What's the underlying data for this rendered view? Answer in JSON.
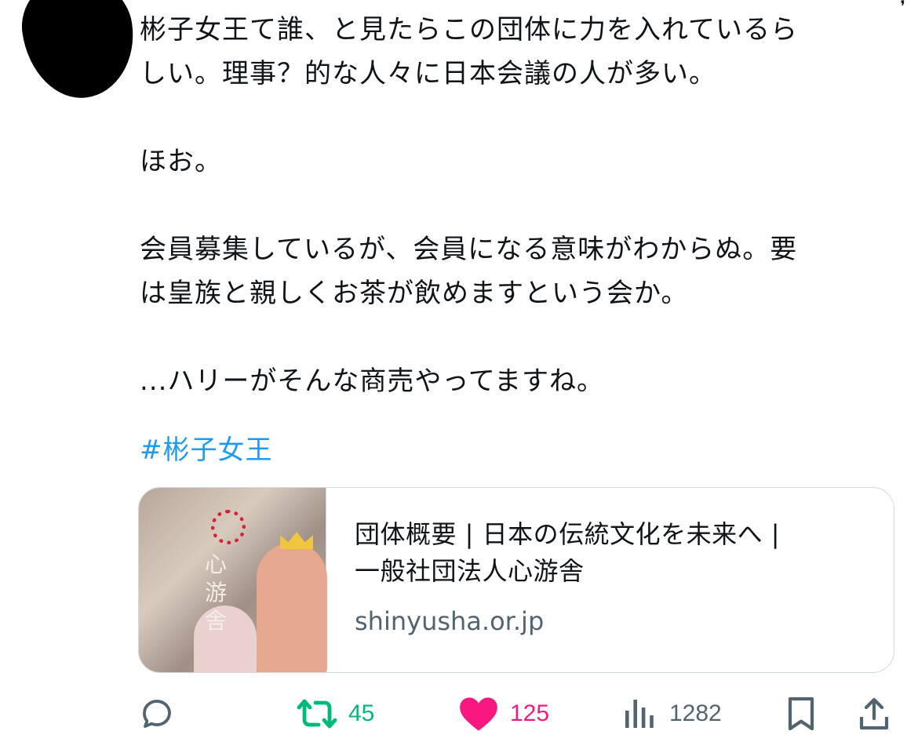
{
  "tweet": {
    "paragraphs": [
      "彬子女王て誰、と見たらこの団体に力を入れているら\nしい。理事？的な人々に日本会議の人が多い。",
      "ほお。",
      "会員募集しているが、会員になる意味がわからぬ。要\nは皇族と親しくお茶が飲めますという会か。",
      "...ハリーがそんな商売やってますね。"
    ],
    "hashtag": "#彬子女王"
  },
  "link_card": {
    "title": "団体概要 | 日本の伝統文化を未来へ |\n一般社団法人心游舎",
    "domain": "shinyusha.or.jp",
    "thumbnail_text": "心游舎"
  },
  "actions": {
    "reply": {
      "icon": "reply-icon",
      "count": ""
    },
    "retweet": {
      "icon": "retweet-icon",
      "count": "45",
      "color": "#00ba7c"
    },
    "like": {
      "icon": "heart-icon",
      "count": "125",
      "color": "#f91880"
    },
    "views": {
      "icon": "views-icon",
      "count": "1282",
      "color": "#536471"
    },
    "bookmark": {
      "icon": "bookmark-icon"
    },
    "share": {
      "icon": "share-icon"
    }
  },
  "colors": {
    "text": "#0f1419",
    "link": "#1d9bf0",
    "muted": "#536471",
    "border": "#cfd9de"
  }
}
